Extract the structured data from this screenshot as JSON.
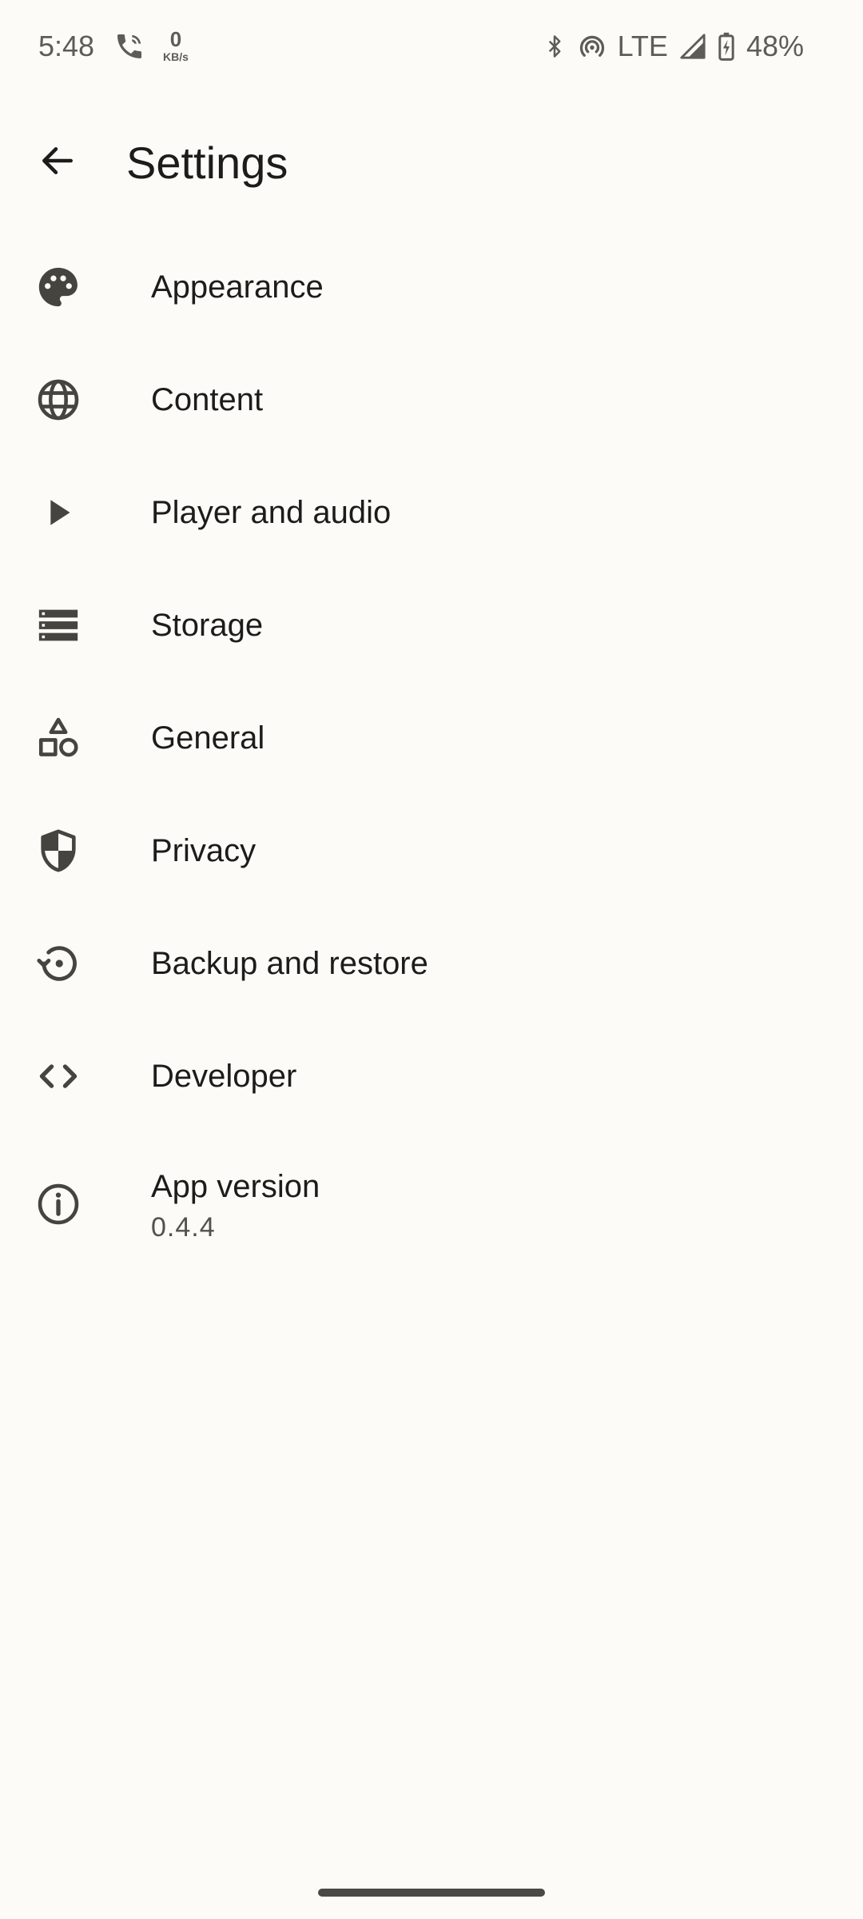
{
  "status_bar": {
    "time": "5:48",
    "net_speed_value": "0",
    "net_speed_unit": "KB/s",
    "network_type": "LTE",
    "battery_percent": "48%"
  },
  "app_bar": {
    "title": "Settings"
  },
  "settings": {
    "items": [
      {
        "label": "Appearance",
        "icon": "palette-icon"
      },
      {
        "label": "Content",
        "icon": "globe-icon"
      },
      {
        "label": "Player and audio",
        "icon": "play-icon"
      },
      {
        "label": "Storage",
        "icon": "storage-icon"
      },
      {
        "label": "General",
        "icon": "shapes-icon"
      },
      {
        "label": "Privacy",
        "icon": "shield-icon"
      },
      {
        "label": "Backup and restore",
        "icon": "restore-icon"
      },
      {
        "label": "Developer",
        "icon": "code-icon"
      },
      {
        "label": "App version",
        "subtitle": "0.4.4",
        "icon": "info-icon"
      }
    ]
  },
  "colors": {
    "background": "#fcfbf7",
    "text_primary": "#1d1c1a",
    "text_secondary": "#52514d",
    "icon": "#45443f"
  }
}
